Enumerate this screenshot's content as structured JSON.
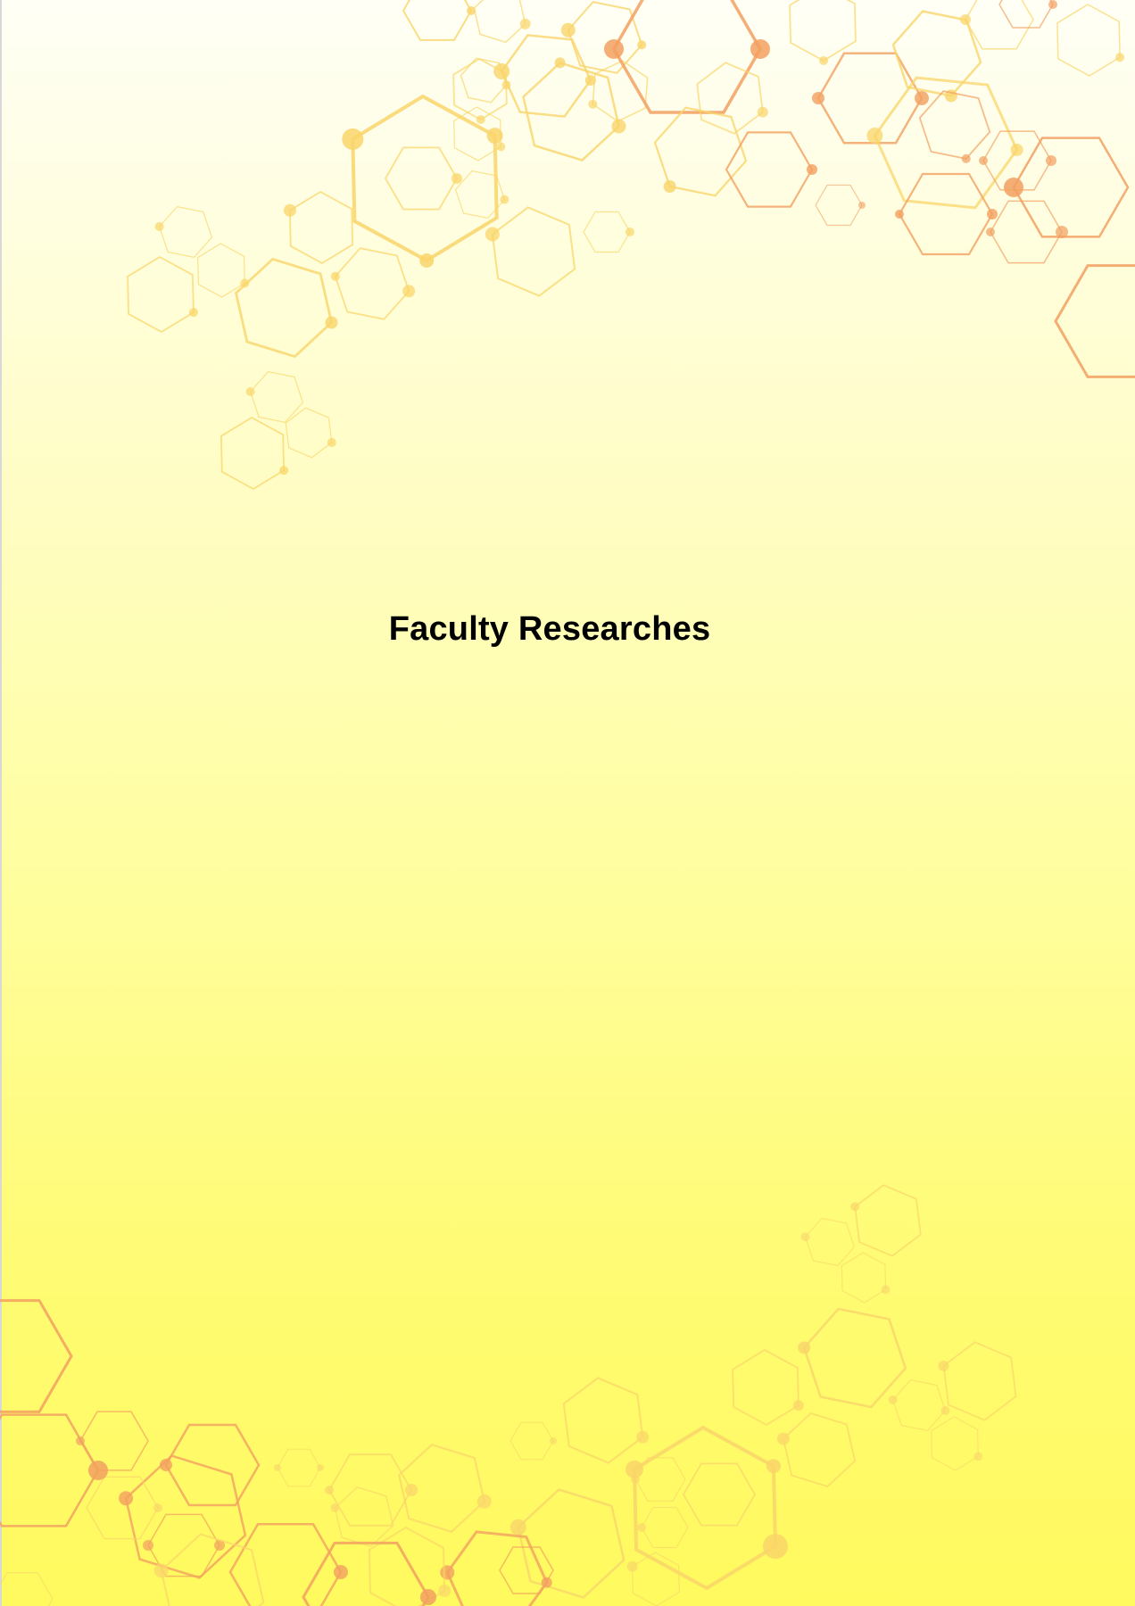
{
  "page": {
    "title": "Faculty Researches"
  },
  "colors": {
    "background_top": "#fffff6",
    "background_bottom": "#fffa5e",
    "hex_yellow": "#f9d56a",
    "hex_orange": "#f2a060",
    "title_text": "#000000"
  },
  "decorations": {
    "top_pattern": "hexagon-molecule-cluster",
    "bottom_pattern": "hexagon-molecule-cluster"
  }
}
